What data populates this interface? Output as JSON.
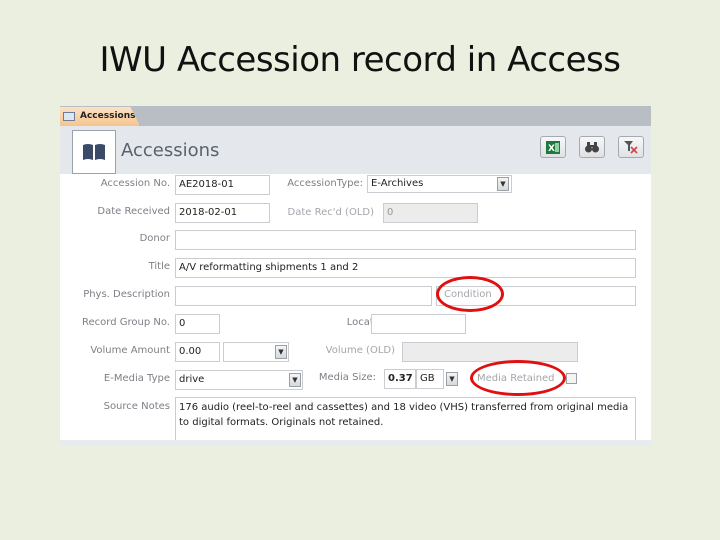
{
  "slide": {
    "title": "IWU Accession record in Access"
  },
  "tab": {
    "label": "Accessions",
    "icon": "form-icon"
  },
  "header": {
    "title": "Accessions",
    "logo_icon": "book-icon",
    "buttons": [
      {
        "name": "export-excel-button",
        "icon": "excel-icon"
      },
      {
        "name": "find-button",
        "icon": "binoculars-icon"
      },
      {
        "name": "clear-filter-button",
        "icon": "filter-clear-icon"
      }
    ]
  },
  "form": {
    "accession_no": {
      "label": "Accession No.",
      "value": "AE2018-01"
    },
    "accession_type": {
      "label": "AccessionType:",
      "value": "E-Archives"
    },
    "date_received": {
      "label": "Date Received",
      "value": "2018-02-01"
    },
    "date_recd_old": {
      "label": "Date Rec'd (OLD)",
      "value": "0"
    },
    "donor": {
      "label": "Donor",
      "value": ""
    },
    "title": {
      "label": "Title",
      "value": "A/V reformatting shipments 1 and 2"
    },
    "phys_description": {
      "label": "Phys. Description",
      "value": ""
    },
    "condition": {
      "label": "Condition",
      "value": ""
    },
    "record_group_no": {
      "label": "Record Group No.",
      "value": "0"
    },
    "location": {
      "label": "Location",
      "value": ""
    },
    "volume_amount": {
      "label": "Volume Amount",
      "value": "0.00",
      "unit": ""
    },
    "volume_old": {
      "label": "Volume (OLD)",
      "value": ""
    },
    "e_media_type": {
      "label": "E-Media Type",
      "value": "drive"
    },
    "media_size": {
      "label": "Media Size:",
      "value": "0.37",
      "unit": "GB"
    },
    "media_retained": {
      "label": "Media Retained",
      "checked": false
    },
    "source_notes": {
      "label": "Source Notes",
      "value": "176 audio (reel-to-reel and cassettes) and 18 video (VHS) transferred from original media to digital formats. Originals not retained."
    }
  },
  "annotations": {
    "highlight_color": "#e01010"
  }
}
